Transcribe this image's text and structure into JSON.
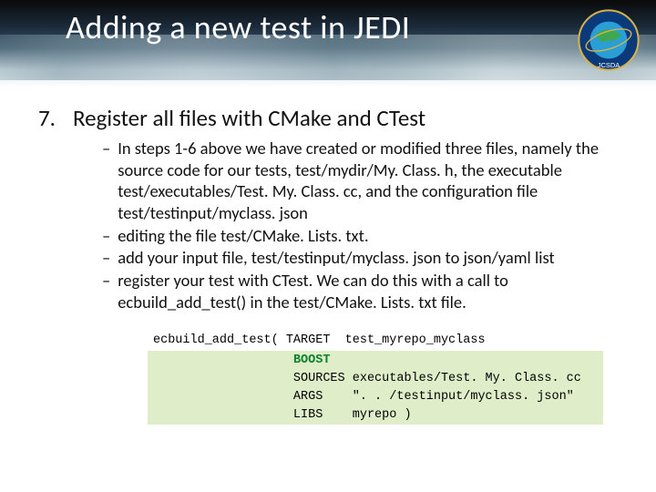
{
  "header": {
    "title": "Adding a new test in JEDI",
    "logo_label": "JCSDA"
  },
  "step": {
    "number": "7.",
    "title": "Register all files with CMake and CTest"
  },
  "bullets": [
    "In steps 1-6 above we have created or modified three files, namely the source code for our tests, test/mydir/My. Class. h, the executable test/executables/Test. My. Class. cc, and the configuration file test/testinput/myclass. json",
    "editing the file test/CMake. Lists. txt.",
    "add your input file, test/testinput/myclass. json to json/yaml list",
    "register your test with CTest. We can do this with a call to ecbuild_add_test() in the test/CMake. Lists. txt file."
  ],
  "code": {
    "l1a": "ecbuild_add_test( TARGET  test_myrepo_myclass",
    "l2_prefix": "                   ",
    "l2_kw": "BOOST",
    "l3": "                   SOURCES executables/Test. My. Class. cc",
    "l4": "                   ARGS    \". . /testinput/myclass. json\"",
    "l5": "                   LIBS    myrepo )"
  }
}
